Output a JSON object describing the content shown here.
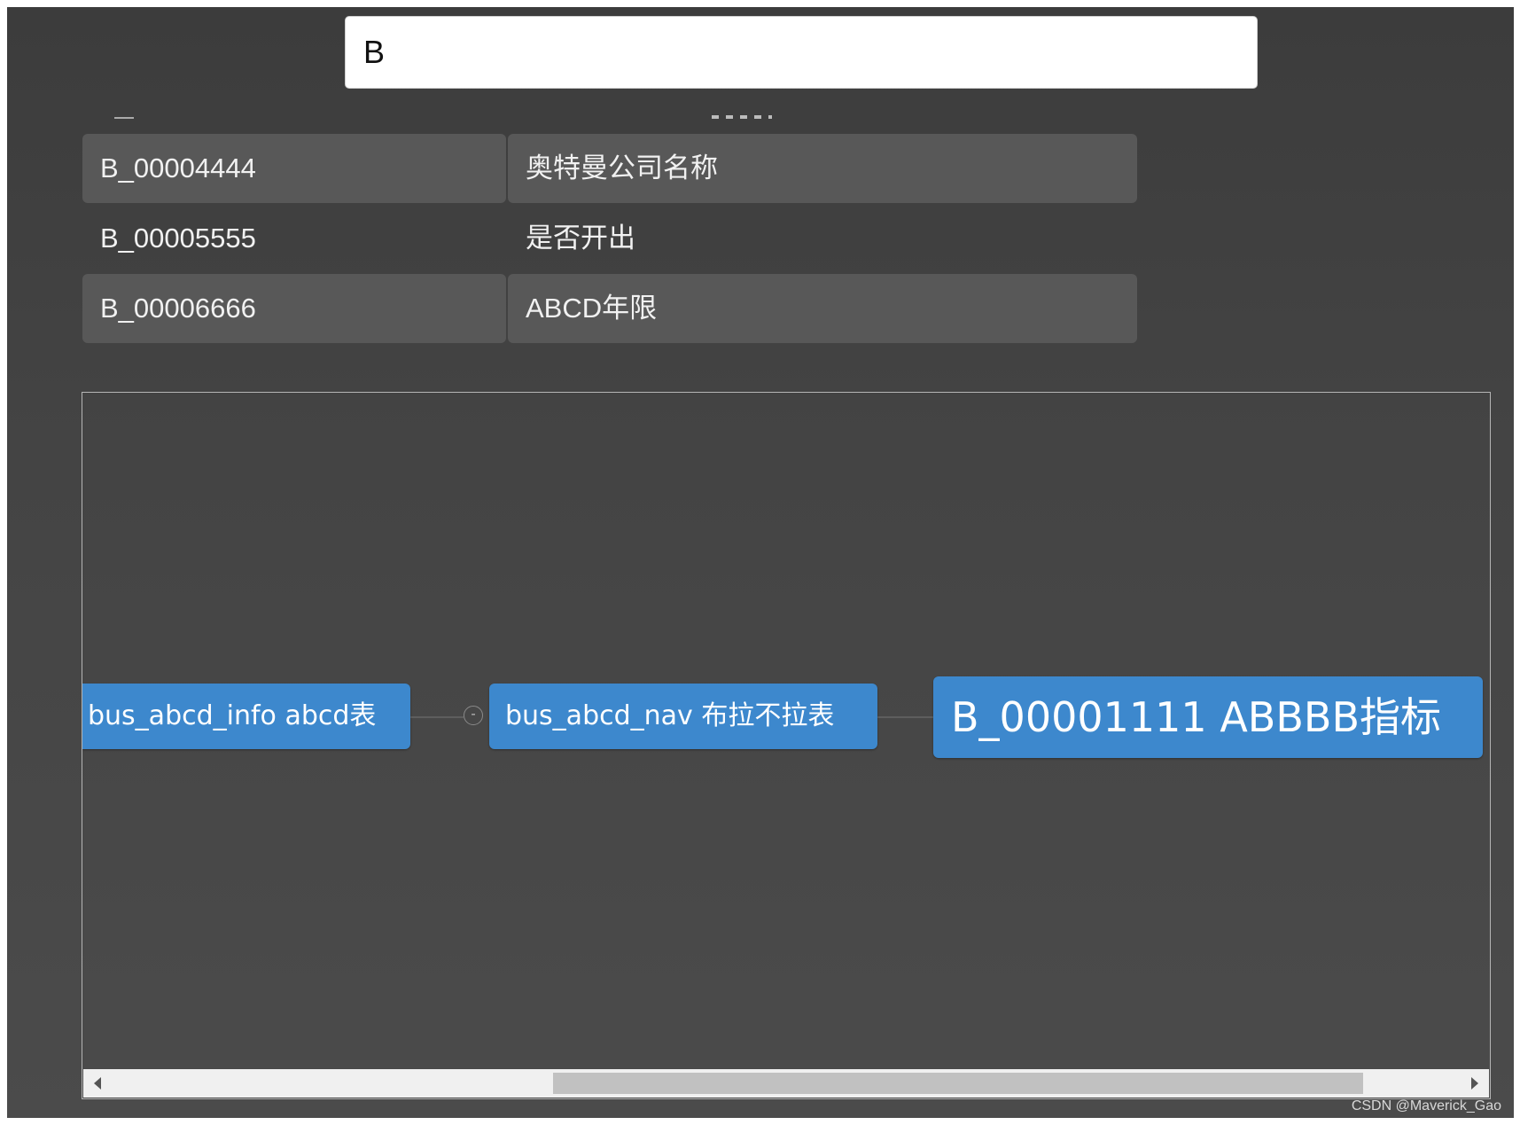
{
  "search": {
    "value": "B"
  },
  "results": [
    {
      "code": "B_00004444",
      "name": "奥特曼公司名称"
    },
    {
      "code": "B_00005555",
      "name": "是否开出"
    },
    {
      "code": "B_00006666",
      "name": "ABCD年限"
    }
  ],
  "graph": {
    "nodes": {
      "source": "bus_abcd_info abcd表",
      "middle": "bus_abcd_nav 布拉不拉表",
      "target": "B_00001111 ABBBB指标"
    },
    "toggle_symbol": "-"
  },
  "watermark": "CSDN @Maverick_Gao"
}
